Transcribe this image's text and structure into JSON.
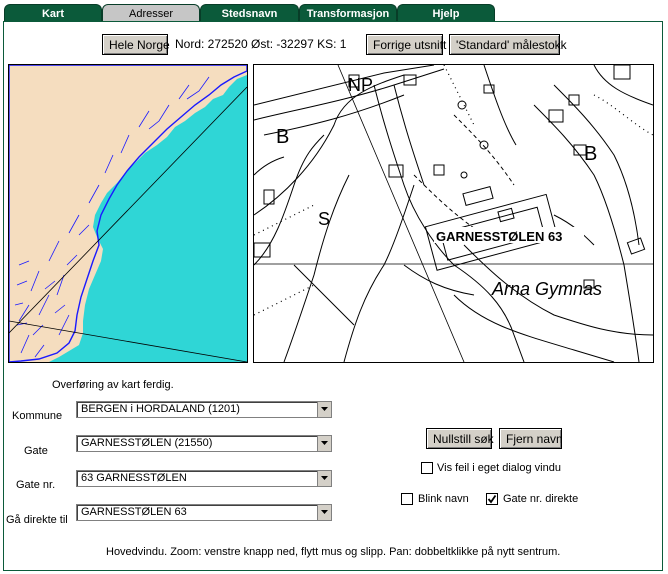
{
  "tabs": [
    {
      "label": "Kart"
    },
    {
      "label": "Adresser"
    },
    {
      "label": "Stedsnavn"
    },
    {
      "label": "Transformasjon"
    },
    {
      "label": "Hjelp"
    }
  ],
  "toolbar": {
    "hele_norge": "Hele Norge",
    "coords": "Nord: 272520 Øst: -32297 KS: 1",
    "forrige": "Forrige utsnitt",
    "standard": "'Standard' målestokk"
  },
  "detail_map": {
    "label_garnes": "GARNESSTØLEN 63",
    "label_arna": "Arna Gymnas",
    "label_b1": "B",
    "label_b2": "B",
    "label_s": "S",
    "label_np": "NP"
  },
  "status": "Overføring av kart ferdig.",
  "form": {
    "kommune_label": "Kommune",
    "kommune_value": "BERGEN i HORDALAND (1201)",
    "gate_label": "Gate",
    "gate_value": "GARNESSTØLEN (21550)",
    "gatenr_label": "Gate nr.",
    "gatenr_value": "63 GARNESSTØLEN",
    "ga_label": "Gå direkte til",
    "ga_value": "GARNESSTØLEN 63"
  },
  "actions": {
    "nullstill": "Nullstill søk",
    "fjern": "Fjern navn",
    "vis_feil": "Vis feil i eget dialog vindu",
    "blink": "Blink navn",
    "gate_direkte": "Gate nr. direkte"
  },
  "checkboxes": {
    "vis_feil": false,
    "blink": false,
    "gate_direkte": true
  },
  "footer": "Hovedvindu. Zoom: venstre knapp ned, flytt mus og slipp. Pan: dobbeltklikke på nytt sentrum.",
  "colors": {
    "tab_green": "#0b5a3a",
    "sea": "#2fd6d6",
    "land": "#f5ddbf",
    "water_lines": "#1a1aff"
  }
}
